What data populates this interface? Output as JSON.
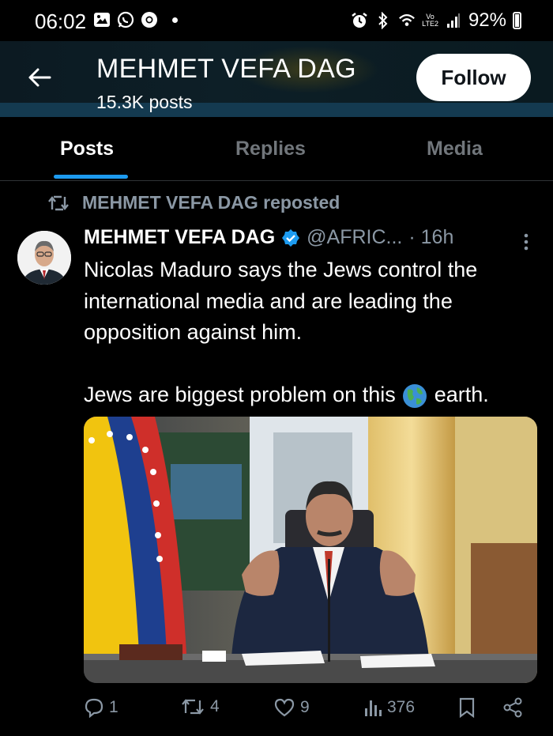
{
  "status_bar": {
    "time": "06:02",
    "network_label_top": "Vo",
    "network_label_bottom": "LTE2",
    "battery": "92%"
  },
  "header": {
    "title": "MEHMET VEFA DAG",
    "subtitle": "15.3K posts",
    "follow_label": "Follow"
  },
  "tabs": [
    {
      "label": "Posts",
      "active": true
    },
    {
      "label": "Replies",
      "active": false
    },
    {
      "label": "Media",
      "active": false
    }
  ],
  "repost_label": "MEHMET VEFA DAG reposted",
  "tweet": {
    "name": "MEHMET VEFA DAG",
    "handle": "@AFRIC...",
    "time": "· 16h",
    "paragraph1": "Nicolas Maduro says the Jews control the international media and are leading the opposition against him.",
    "paragraph2_before": "Jews are biggest problem on this",
    "paragraph2_after": "earth.",
    "actions": {
      "replies": "1",
      "reposts": "4",
      "likes": "9",
      "views": "376"
    }
  },
  "colors": {
    "accent": "#1d9bf0",
    "background": "#000000",
    "muted": "#8b98a5"
  },
  "icons": [
    "gallery-icon",
    "whatsapp-icon",
    "chrome-icon",
    "alarm-icon",
    "bluetooth-icon",
    "wifi-icon",
    "signal-icon",
    "battery-icon",
    "back-arrow-icon",
    "repost-icon",
    "verified-icon",
    "more-icon",
    "globe-icon",
    "reply-icon",
    "like-icon",
    "views-icon",
    "bookmark-icon",
    "share-icon"
  ]
}
